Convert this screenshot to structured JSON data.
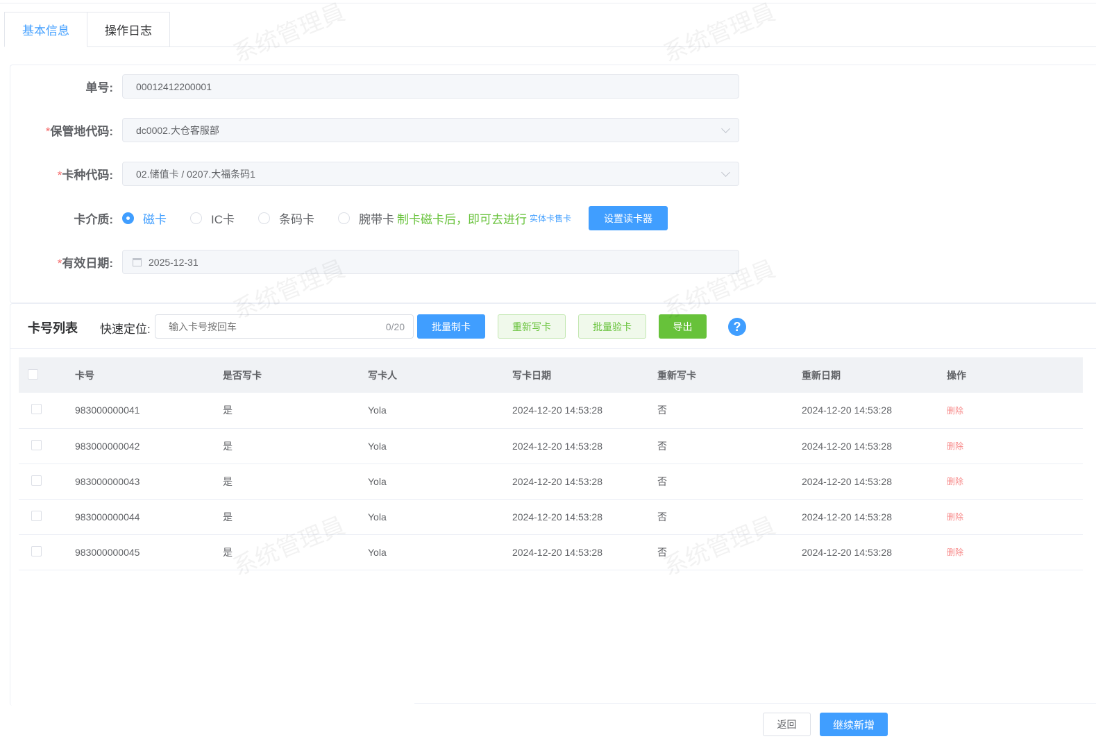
{
  "tabs": [
    "基本信息",
    "操作日志"
  ],
  "form": {
    "order_no": {
      "label": "单号:",
      "value": "00012412200001"
    },
    "location": {
      "label": "保管地代码:",
      "value": "dc0002.大仓客服部"
    },
    "card_type": {
      "label": "卡种代码:",
      "value": "02.储值卡 / 0207.大福条码1"
    },
    "medium": {
      "label": "卡介质:",
      "options": [
        "磁卡",
        "IC卡",
        "条码卡",
        "腕带卡"
      ],
      "selected": "磁卡",
      "hint": "制卡磁卡后，即可去进行",
      "hint_link": "实体卡售卡",
      "reader_button": "设置读卡器"
    },
    "expiry": {
      "label": "有效日期:",
      "value": "2025-12-31"
    },
    "required_mark": "*"
  },
  "card_list": {
    "title": "卡号列表",
    "quick_label": "快速定位:",
    "search_placeholder": "输入卡号按回车",
    "search_count": "0/20",
    "buttons": {
      "batch_make": "批量制卡",
      "rewrite": "重新写卡",
      "batch_verify": "批量验卡",
      "export": "导出"
    },
    "columns": [
      "卡号",
      "是否写卡",
      "写卡人",
      "写卡日期",
      "重新写卡",
      "重新日期",
      "操作"
    ],
    "rows": [
      [
        "983000000041",
        "是",
        "Yola",
        "2024-12-20 14:53:28",
        "否",
        "2024-12-20 14:53:28",
        "删除"
      ],
      [
        "983000000042",
        "是",
        "Yola",
        "2024-12-20 14:53:28",
        "否",
        "2024-12-20 14:53:28",
        "删除"
      ],
      [
        "983000000043",
        "是",
        "Yola",
        "2024-12-20 14:53:28",
        "否",
        "2024-12-20 14:53:28",
        "删除"
      ],
      [
        "983000000044",
        "是",
        "Yola",
        "2024-12-20 14:53:28",
        "否",
        "2024-12-20 14:53:28",
        "删除"
      ],
      [
        "983000000045",
        "是",
        "Yola",
        "2024-12-20 14:53:28",
        "否",
        "2024-12-20 14:53:28",
        "删除"
      ]
    ]
  },
  "footer": {
    "back": "返回",
    "continue": "继续新增"
  },
  "watermark": "系统管理員",
  "colors": {
    "primary": "#409eff",
    "success": "#67c23a",
    "danger": "#f56c6c"
  }
}
